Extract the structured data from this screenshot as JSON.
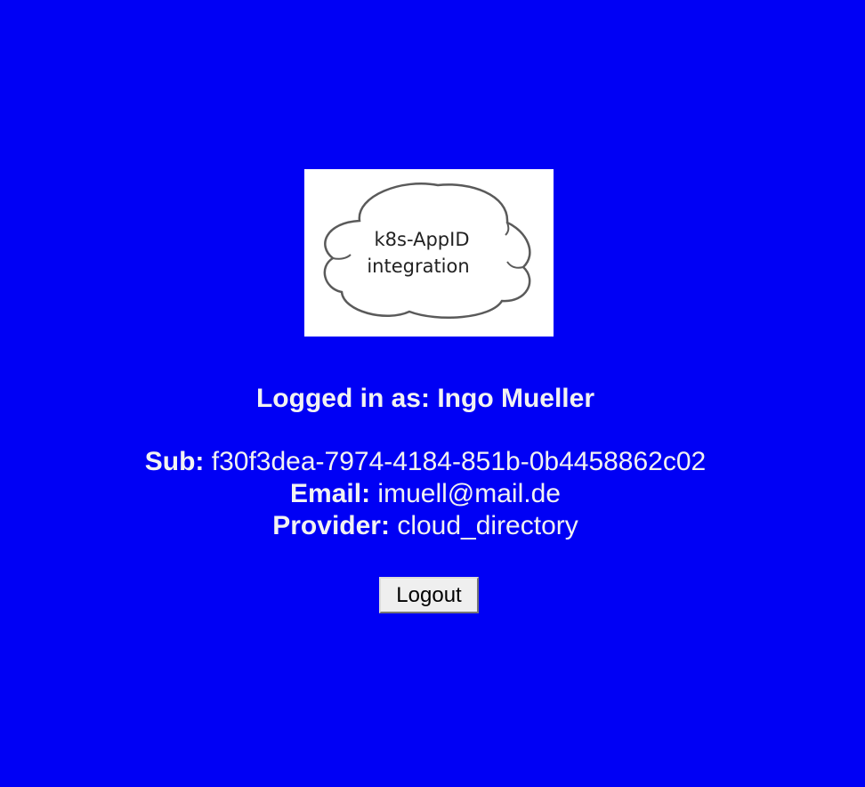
{
  "logo": {
    "line1": "k8s-AppID",
    "line2": "integration"
  },
  "user": {
    "logged_in_label": "Logged in as:",
    "name": "Ingo Mueller"
  },
  "details": {
    "sub_label": "Sub:",
    "sub_value": "f30f3dea-7974-4184-851b-0b4458862c02",
    "email_label": "Email:",
    "email_value": "imuell@mail.de",
    "provider_label": "Provider:",
    "provider_value": "cloud_directory"
  },
  "actions": {
    "logout_label": "Logout"
  },
  "colors": {
    "background": "#0000f5",
    "text": "#f2f2f2"
  }
}
